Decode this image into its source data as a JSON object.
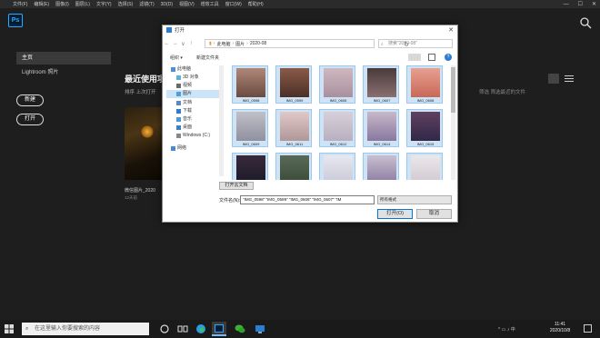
{
  "menubar": [
    "文件(F)",
    "编辑(E)",
    "图像(I)",
    "图层(L)",
    "文字(Y)",
    "选择(S)",
    "滤镜(T)",
    "3D(D)",
    "视图(V)",
    "增效工具",
    "窗口(W)",
    "帮助(H)"
  ],
  "window_controls": [
    "—",
    "☐",
    "✕"
  ],
  "app": {
    "logo": "Ps"
  },
  "sidebar": {
    "home": "主页",
    "lightroom": "Lightroom 照片",
    "new_label": "新建",
    "open_label": "打开"
  },
  "main": {
    "recent_title": "最近使用项",
    "sort_text": "排序  上次打开",
    "filter_placeholder": "筛选  筛选最近的文件",
    "recent_file": {
      "name": "微信图片_2020",
      "size": "12天前"
    }
  },
  "dialog": {
    "title": "打开",
    "close": "✕",
    "nav_buttons": [
      "←",
      "→",
      "∨",
      "↑"
    ],
    "breadcrumb": [
      "此电脑",
      "图片",
      "2020-08"
    ],
    "refresh": "↻",
    "search_placeholder": "搜索\"2020-08\"",
    "organize": "组织 ▾",
    "new_folder": "新建文件夹",
    "help": "?",
    "nav_items": [
      {
        "label": "此电脑",
        "color": "#4a90d9"
      },
      {
        "label": "3D 对象",
        "color": "#5bb0e0"
      },
      {
        "label": "视频",
        "color": "#6a6a6a"
      },
      {
        "label": "图片",
        "color": "#4fa0d8",
        "selected": true
      },
      {
        "label": "文档",
        "color": "#5a8ac0"
      },
      {
        "label": "下载",
        "color": "#2b7cd3"
      },
      {
        "label": "音乐",
        "color": "#4a9ad8"
      },
      {
        "label": "桌面",
        "color": "#3a7fc8"
      },
      {
        "label": "Windows (C:)",
        "color": "#888888"
      },
      {
        "label": "网络",
        "color": "#4a8ad0"
      }
    ],
    "files": [
      {
        "label": "IMG_0598",
        "c1": "#b08878",
        "c2": "#6a4a40"
      },
      {
        "label": "IMG_0599",
        "c1": "#8a5a48",
        "c2": "#4a3028"
      },
      {
        "label": "IMG_0606",
        "c1": "#d0b8c0",
        "c2": "#a890a0"
      },
      {
        "label": "IMG_0607",
        "c1": "#4a3a3a",
        "c2": "#8a7070"
      },
      {
        "label": "IMG_0608",
        "c1": "#e8a090",
        "c2": "#c86858"
      },
      {
        "label": "IMG_0609",
        "c1": "#c0c0c8",
        "c2": "#9090a0"
      },
      {
        "label": "IMG_0611",
        "c1": "#e0c8c8",
        "c2": "#b09898"
      },
      {
        "label": "IMG_0612",
        "c1": "#d8d0d8",
        "c2": "#b8b0c0"
      },
      {
        "label": "IMG_0614",
        "c1": "#c8b8c8",
        "c2": "#8878a0"
      },
      {
        "label": "IMG_0615",
        "c1": "#604060",
        "c2": "#302848"
      },
      {
        "label": "",
        "c1": "#3a2a3a",
        "c2": "#1a1a28"
      },
      {
        "label": "",
        "c1": "#5a6a58",
        "c2": "#3a4a38"
      },
      {
        "label": "",
        "c1": "#e8e8f0",
        "c2": "#c8c8d8"
      },
      {
        "label": "",
        "c1": "#c8c0d0",
        "c2": "#8878a0"
      },
      {
        "label": "",
        "c1": "#eae8ea",
        "c2": "#d0c8d0"
      }
    ],
    "show_folder_btn": "打开云文档",
    "filename_label": "文件名(N):",
    "filename_value": "\"IMG_0598\" \"IMG_0599\" \"IMG_0606\" \"IMG_0607\" \"IM",
    "filetype": "所有格式",
    "open_btn": "打开(O)",
    "cancel_btn": "取消"
  },
  "taskbar": {
    "search_placeholder": "在这里输入你要搜索的内容",
    "tray_text": "^  ▭  ♪  中",
    "time": "11:41",
    "date": "2020/10/8"
  }
}
